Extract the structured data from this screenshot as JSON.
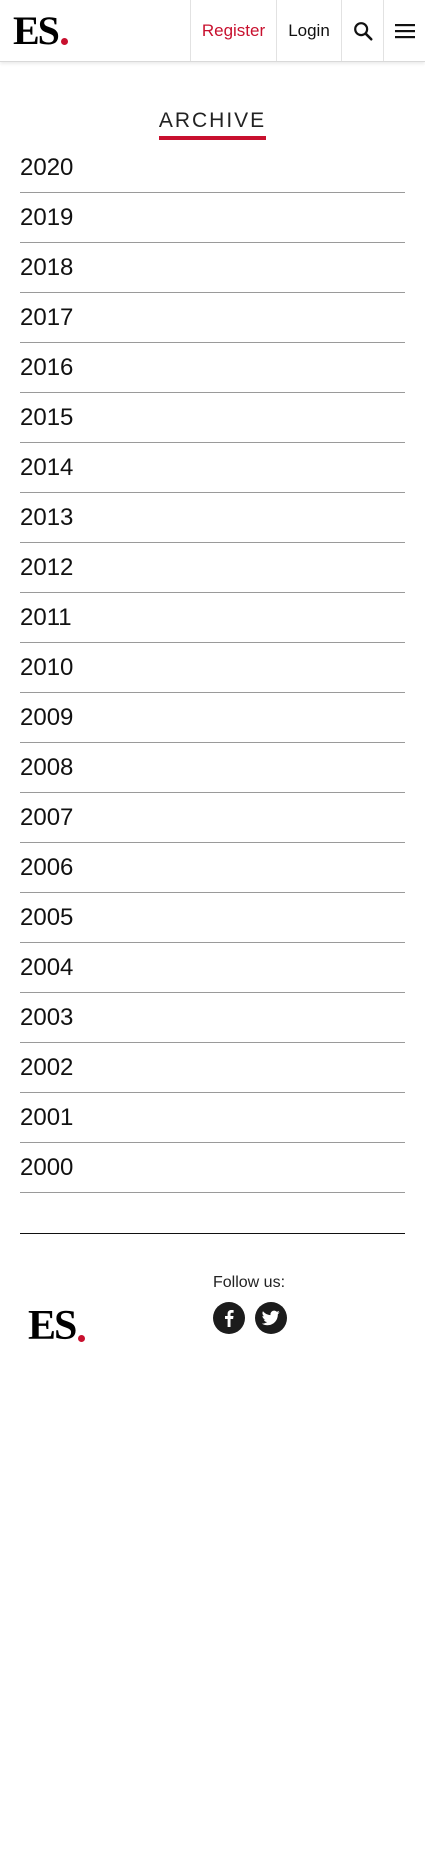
{
  "header": {
    "logo_text": "ES",
    "register_label": "Register",
    "login_label": "Login",
    "search_icon": "search-icon",
    "menu_icon": "hamburger-menu-icon"
  },
  "archive": {
    "title": "ARCHIVE",
    "years": [
      "2020",
      "2019",
      "2018",
      "2017",
      "2016",
      "2015",
      "2014",
      "2013",
      "2012",
      "2011",
      "2010",
      "2009",
      "2008",
      "2007",
      "2006",
      "2005",
      "2004",
      "2003",
      "2002",
      "2001",
      "2000"
    ]
  },
  "footer": {
    "logo_text": "ES",
    "follow_label": "Follow us:",
    "social": [
      "facebook-icon",
      "twitter-icon"
    ]
  },
  "colors": {
    "accent": "#c8102e",
    "text": "#111111",
    "divider": "#9a9a9a"
  }
}
